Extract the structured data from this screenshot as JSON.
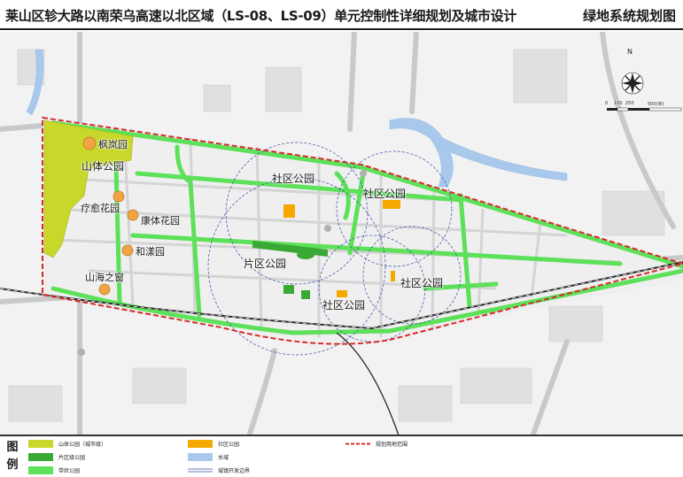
{
  "title": {
    "main": "莱山区轸大路以南荣乌高速以北区域（LS-08、LS-09）单元控制性详细规划及城市设计",
    "right": "绿地系统规划图"
  },
  "map": {
    "labels": {
      "fenglan": "枫岚园",
      "shanti": "山体公园",
      "liaoyu": "疗愈花园",
      "kangti": "康体花园",
      "heyang": "和漾园",
      "shanhai": "山海之窗",
      "shequ1": "社区公园",
      "shequ2": "社区公园",
      "shequ3": "社区公园",
      "shequ4": "社区公园",
      "pianqu": "片区公园"
    },
    "compass": {
      "north": "N",
      "scale_ticks": [
        "0",
        "100",
        "250",
        "500(米)"
      ]
    },
    "colors": {
      "mountain_park": "#c8d82a",
      "community_park": "#f5a800",
      "district_park": "#3aa835",
      "belt_park": "#5de05a",
      "water": "#a9c9ec",
      "boundary_red": "#d62b2b",
      "growth_boundary": "#3b4aa8",
      "base": "#f2f2f2",
      "railway": "#2a2a2a"
    }
  },
  "legend": {
    "title": "图例",
    "items": [
      {
        "key": "mountain_park",
        "label": "山体公园（城市级）"
      },
      {
        "key": "community_park",
        "label": "社区公园"
      },
      {
        "key": "planning_boundary",
        "label": "规划用地范围"
      },
      {
        "key": "district_park",
        "label": "片区级公园"
      },
      {
        "key": "water",
        "label": "水域"
      },
      {
        "key": "belt_park",
        "label": "带状公园"
      },
      {
        "key": "growth_boundary",
        "label": "城镇开发边界"
      }
    ]
  }
}
